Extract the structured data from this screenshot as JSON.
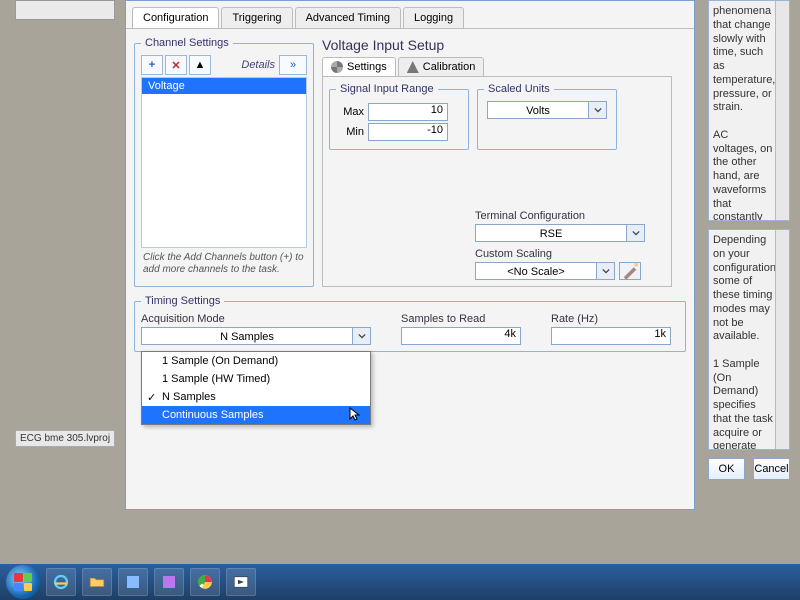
{
  "tabs": {
    "configuration": "Configuration",
    "triggering": "Triggering",
    "advanced": "Advanced Timing",
    "logging": "Logging"
  },
  "channel": {
    "legend": "Channel Settings",
    "details": "Details",
    "item": "Voltage",
    "hint": "Click the Add Channels button (+) to add more channels to the task."
  },
  "vis": {
    "title": "Voltage Input Setup",
    "settings": "Settings",
    "calibration": "Calibration",
    "signal_legend": "Signal Input Range",
    "max_lbl": "Max",
    "max_val": "10",
    "min_lbl": "Min",
    "min_val": "-10",
    "scaled_legend": "Scaled Units",
    "scaled_val": "Volts",
    "term_lbl": "Terminal Configuration",
    "term_val": "RSE",
    "cscale_lbl": "Custom Scaling",
    "cscale_val": "<No Scale>"
  },
  "timing": {
    "legend": "Timing Settings",
    "acq_lbl": "Acquisition Mode",
    "acq_val": "N Samples",
    "opts": {
      "o1": "1 Sample (On Demand)",
      "o2": "1 Sample (HW Timed)",
      "o3": "N Samples",
      "o4": "Continuous Samples"
    },
    "str_lbl": "Samples to Read",
    "str_val": "4k",
    "rate_lbl": "Rate (Hz)",
    "rate_val": "1k"
  },
  "help": {
    "p1": "phenomena that change slowly with time, such as temperature, pressure, or strain.\n\nAC voltages, on the other hand, are waveforms that constantly increase,",
    "p2": "Depending on your configuration, some of these timing modes may not be available.\n\n1 Sample (On Demand) specifies that the task acquire or generate one"
  },
  "buttons": {
    "ok": "OK",
    "cancel": "Cancel"
  },
  "project": "ECG bme 305.lvproj"
}
